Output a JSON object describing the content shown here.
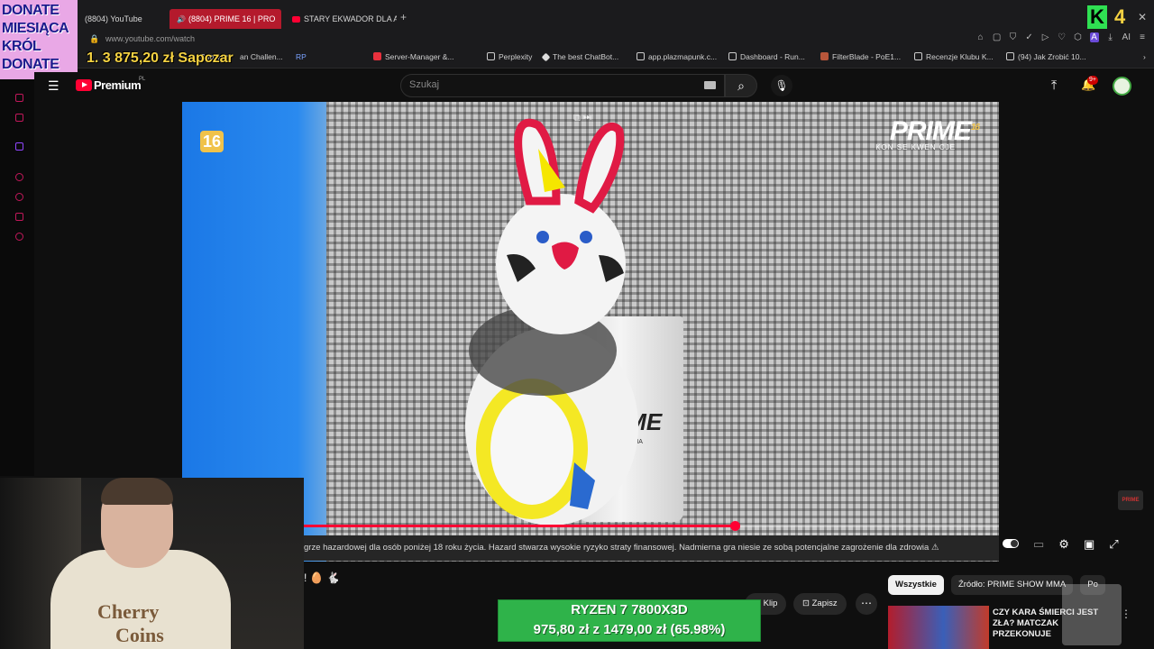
{
  "browser": {
    "tabs": [
      {
        "label": "(8804) YouTube"
      },
      {
        "label": "(8804) PRIME 16 | PRO"
      },
      {
        "label": "STARY EKWADOR DLA AS"
      }
    ],
    "new_tab": "+",
    "url": "www.youtube.com/watch",
    "bookmarks": [
      {
        "label": "Sapczar"
      },
      {
        "label": "an Challen..."
      },
      {
        "label": "RP"
      },
      {
        "label": "Server-Manager &..."
      },
      {
        "label": "Perplexity"
      },
      {
        "label": "The best ChatBot..."
      },
      {
        "label": "app.plazmapunk.c..."
      },
      {
        "label": "Dashboard - Run..."
      },
      {
        "label": "FilterBlade - PoE1..."
      },
      {
        "label": "Recenzje Klubu K..."
      },
      {
        "label": "(94) Jak Zrobić 10..."
      }
    ],
    "extension_label": "AI"
  },
  "stream_overlay": {
    "donate_lines": [
      "DONATE",
      "MIESIĄCA",
      "KRÓL",
      "DONATE"
    ],
    "donate_counter": "1. 3 875,20 zł Sapczar",
    "top_right_k": "K",
    "top_right_number": "4",
    "ryzen_line1": "RYZEN 7 7800X3D",
    "ryzen_line2": "975,80 zł z 1479,00 zł (65.98%)",
    "ryzen_progress": 0.6598,
    "colors": {
      "donate_bg": "#e9a8e6",
      "ryzen_bg": "#2fb34a",
      "counter": "#f5d242"
    }
  },
  "youtube": {
    "logo_text": "Premium",
    "logo_region": "PL",
    "search_placeholder": "Szukaj",
    "notification_badge": "9+",
    "player": {
      "age_badge": "16",
      "prime_logo": "PRIME",
      "prime_logo_sup": "16",
      "prime_subtitle": "KON SE KWEN CJE",
      "cup_text": "IME",
      "cup_subtext": "W MMA",
      "progress_fraction": 0.62,
      "disclaimer": "grze hazardowej dla osób poniżej 18 roku życia. Hazard stwarza wysokie ryzyko straty finansowej. Nadmierna gra niesie ze sobą potencjalne zagrożenie dla zdrowia ⚠",
      "side_icon_text": "PRIME"
    },
    "actions": {
      "clip": "Klip",
      "save": "Zapisz",
      "more": "⋯"
    },
    "chips": [
      {
        "label": "Wszystkie",
        "selected": true
      },
      {
        "label": "Źródło: PRIME SHOW MMA",
        "selected": false
      },
      {
        "label": "Po",
        "selected": false
      }
    ],
    "recommendation": {
      "title": "CZY KARA ŚMIERCI JEST ZŁA? MATCZAK PRZEKONUJE"
    }
  },
  "webcam": {
    "hoodie_line1": "Cherry",
    "hoodie_line2": "Coins"
  }
}
